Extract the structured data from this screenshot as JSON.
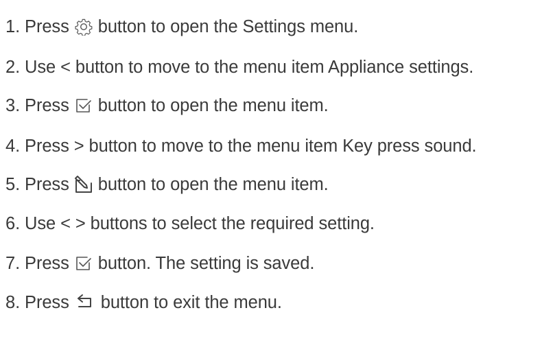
{
  "steps": [
    {
      "before": "1. Press",
      "icon": "gear-icon",
      "after": "button to open the Settings menu."
    },
    {
      "text": "2. Use < button to move to the menu item Appliance settings."
    },
    {
      "before": "3. Press",
      "icon": "checkbox-check-icon",
      "after": "button to open the menu item."
    },
    {
      "text": "4. Press > button to move to the menu item Key press sound."
    },
    {
      "before": "5. Press",
      "icon": "edit-pencil-icon",
      "after": "button to open the menu item."
    },
    {
      "text": "6. Use < > buttons to select the required setting."
    },
    {
      "before": "7. Press",
      "icon": "checkbox-check-icon",
      "after": "button. The setting is saved."
    },
    {
      "before": "8. Press",
      "icon": "back-arrow-icon",
      "after": "button to exit the menu."
    }
  ]
}
